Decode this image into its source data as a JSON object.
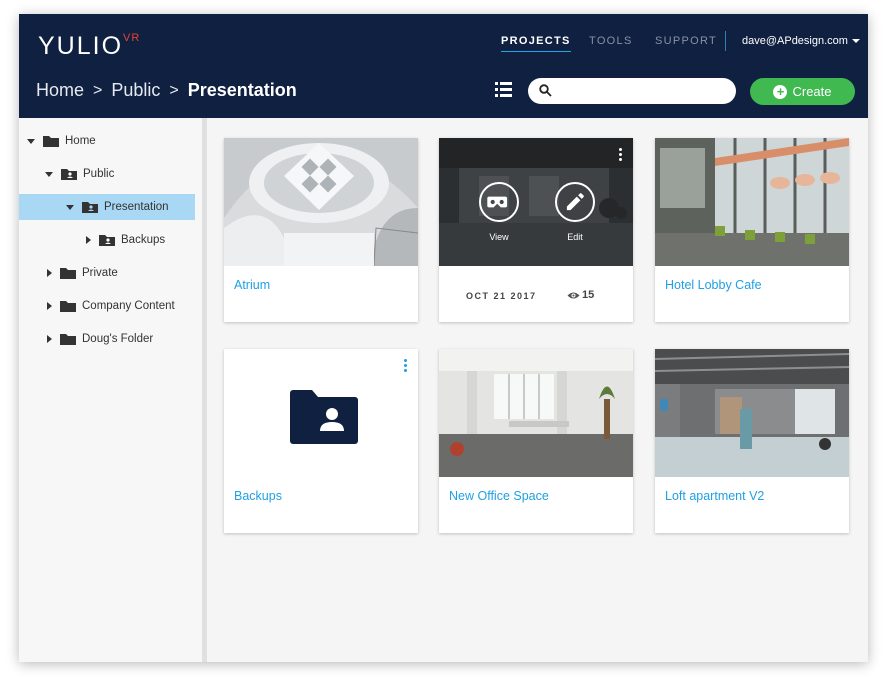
{
  "app": {
    "logo": "YULIO",
    "logo_sup": "VR"
  },
  "nav": {
    "projects": "PROJECTS",
    "tools": "TOOLS",
    "support": "SUPPORT"
  },
  "user": {
    "email": "dave@APdesign.com"
  },
  "breadcrumb": {
    "home": "Home",
    "sep1": ">",
    "public": "Public",
    "sep2": ">",
    "current": "Presentation"
  },
  "search": {
    "placeholder": "",
    "value": ""
  },
  "create_label": "Create",
  "sidebar": {
    "items": [
      {
        "label": "Home"
      },
      {
        "label": "Public"
      },
      {
        "label": "Presentation"
      },
      {
        "label": "Backups"
      },
      {
        "label": "Private"
      },
      {
        "label": "Company Content"
      },
      {
        "label": "Doug's Folder"
      }
    ]
  },
  "cards": [
    {
      "title": "Atrium"
    },
    {
      "date": "OCT 21 2017",
      "views": "15",
      "view_label": "View",
      "edit_label": "Edit"
    },
    {
      "title": "Hotel Lobby Cafe"
    },
    {
      "title": "Backups"
    },
    {
      "title": "New Office Space"
    },
    {
      "title": "Loft apartment V2"
    }
  ],
  "colors": {
    "header": "#0f2040",
    "accent": "#1fa0e4",
    "create": "#3fb950",
    "selected": "#a9d8f5",
    "folder": "#0f2040"
  }
}
